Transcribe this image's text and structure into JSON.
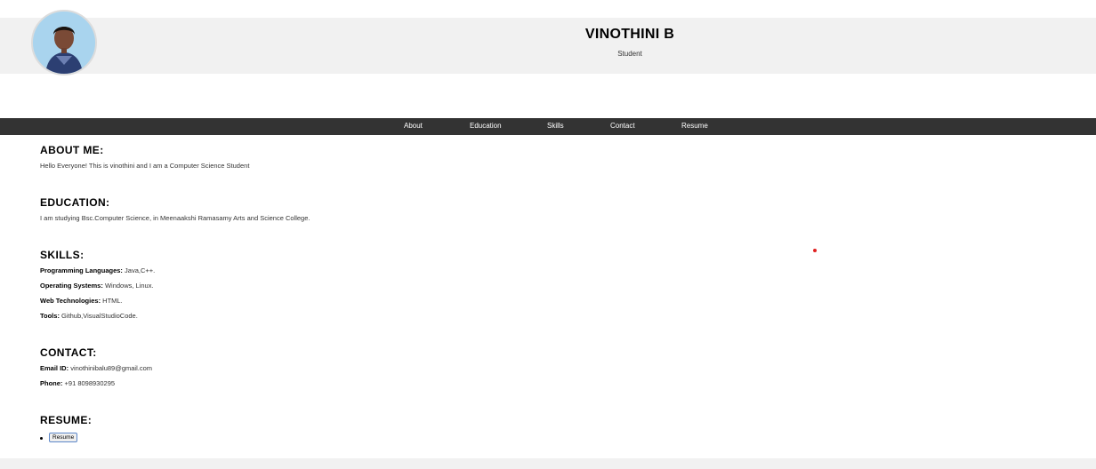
{
  "header": {
    "name": "VINOTHINI B",
    "role": "Student"
  },
  "nav": {
    "items": [
      {
        "label": "About"
      },
      {
        "label": "Education"
      },
      {
        "label": "Skills"
      },
      {
        "label": "Contact"
      },
      {
        "label": "Resume"
      }
    ]
  },
  "about": {
    "title": "ABOUT ME:",
    "text": "Hello Everyone! This is vinothini and I am a Computer Science Student"
  },
  "education": {
    "title": "EDUCATION:",
    "text": "I am studying Bsc.Computer Science, in Meenaakshi Ramasamy Arts and Science College."
  },
  "skills": {
    "title": "SKILLS:",
    "items": [
      {
        "label": "Programming Languages:",
        "value": "Java,C++."
      },
      {
        "label": "Operating Systems:",
        "value": "Windows, Linux."
      },
      {
        "label": "Web Technologies:",
        "value": "HTML."
      },
      {
        "label": "Tools:",
        "value": "Github,VisualStudioCode."
      }
    ]
  },
  "contact": {
    "title": "CONTACT:",
    "items": [
      {
        "label": "Email ID:",
        "value": "vinothinibalu89@gmail.com"
      },
      {
        "label": "Phone:",
        "value": "+91 8098930295"
      }
    ]
  },
  "resume": {
    "title": "RESUME:",
    "button_label": "Resume"
  },
  "colors": {
    "header_bg": "#f1f1f1",
    "nav_bg": "#333333",
    "nav_text": "#ffffff",
    "button_border": "#5d87c9"
  }
}
